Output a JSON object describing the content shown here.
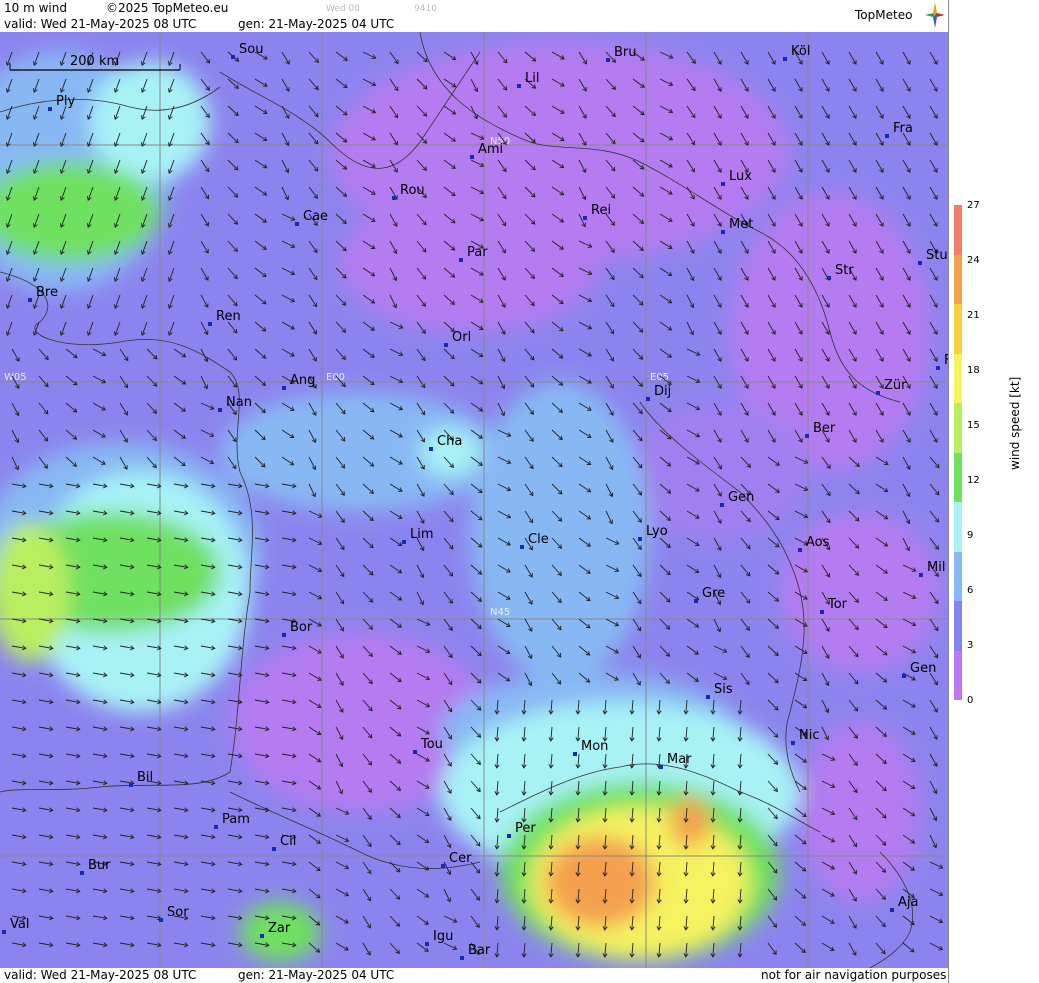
{
  "header": {
    "product": "10 m wind",
    "copyright": "©2025 TopMeteo.eu",
    "faint_label": "Wed 00",
    "faint_code": "9410",
    "valid": "valid:  Wed  21-May-2025  08 UTC",
    "gen": "gen: 21-May-2025 04 UTC",
    "logo": "TopMeteo"
  },
  "footer": {
    "valid": "valid:  Wed  21-May-2025  08 UTC",
    "gen": "gen: 21-May-2025 04 UTC",
    "disclaimer": "not for air navigation purposes"
  },
  "scale_bar": {
    "label": "200 km"
  },
  "legend": {
    "title": "wind speed [kt]",
    "ticks": [
      "27",
      "24",
      "21",
      "18",
      "15",
      "12",
      "9",
      "6",
      "3",
      "0"
    ],
    "colors": [
      "#f08068",
      "#f4a050",
      "#f6d040",
      "#f6f260",
      "#b8ef60",
      "#70e060",
      "#a8f2f6",
      "#88b8f4",
      "#8484ee",
      "#c078f0"
    ]
  },
  "grid_labels": {
    "n50": "N50",
    "n45": "N45",
    "w05": "W05",
    "e00": "E00",
    "e05": "E05"
  },
  "cities": [
    {
      "name": "Sou"
    },
    {
      "name": "Ply"
    },
    {
      "name": "Lil"
    },
    {
      "name": "Bru"
    },
    {
      "name": "Köl"
    },
    {
      "name": "Ami"
    },
    {
      "name": "Fra"
    },
    {
      "name": "Rou"
    },
    {
      "name": "Cae"
    },
    {
      "name": "Lux"
    },
    {
      "name": "Rei"
    },
    {
      "name": "Met"
    },
    {
      "name": "Par"
    },
    {
      "name": "Stu"
    },
    {
      "name": "Bre"
    },
    {
      "name": "Str"
    },
    {
      "name": "Ren"
    },
    {
      "name": "Orl"
    },
    {
      "name": "Ang"
    },
    {
      "name": "Dij"
    },
    {
      "name": "Zür"
    },
    {
      "name": "Nan"
    },
    {
      "name": "Ber"
    },
    {
      "name": "Cha"
    },
    {
      "name": "Gen"
    },
    {
      "name": "Lim"
    },
    {
      "name": "Cle"
    },
    {
      "name": "Lyo"
    },
    {
      "name": "Aos"
    },
    {
      "name": "Mil"
    },
    {
      "name": "Gre"
    },
    {
      "name": "Tor"
    },
    {
      "name": "Bor"
    },
    {
      "name": "Sis"
    },
    {
      "name": "Gen"
    },
    {
      "name": "Tou"
    },
    {
      "name": "Mon"
    },
    {
      "name": "Mar"
    },
    {
      "name": "Nic"
    },
    {
      "name": "Bil"
    },
    {
      "name": "Pam"
    },
    {
      "name": "Cil"
    },
    {
      "name": "Per"
    },
    {
      "name": "Bur"
    },
    {
      "name": "Cer"
    },
    {
      "name": "Aja"
    },
    {
      "name": "Sor"
    },
    {
      "name": "Val"
    },
    {
      "name": "Zar"
    },
    {
      "name": "Igu"
    },
    {
      "name": "Bar"
    },
    {
      "name": "F"
    }
  ]
}
